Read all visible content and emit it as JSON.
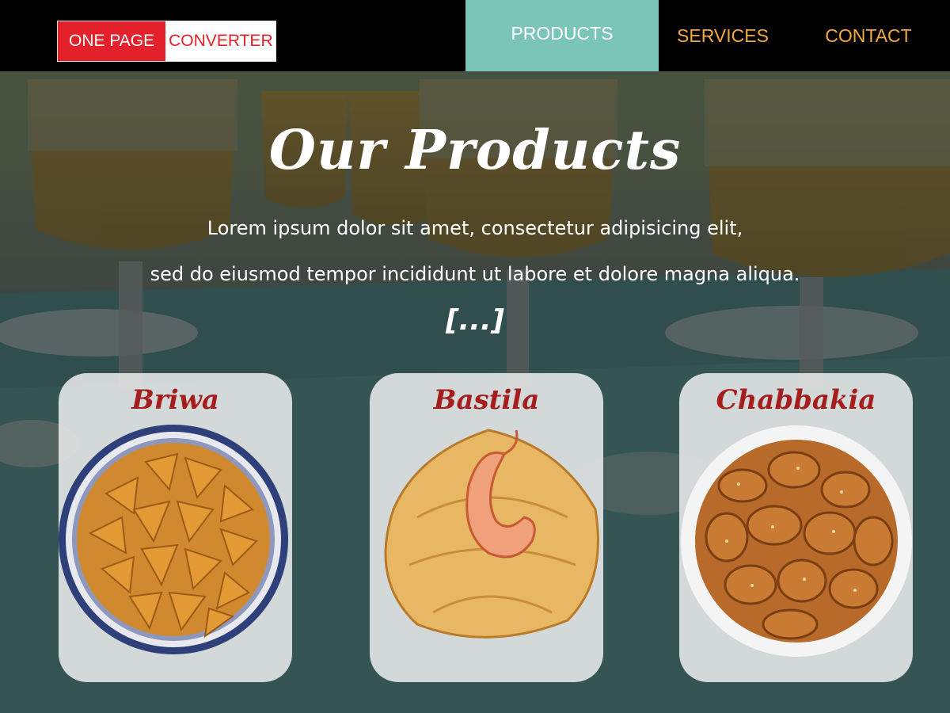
{
  "header": {
    "logo_left": "ONE PAGE",
    "logo_right": "CONVERTER",
    "nav": [
      "PRODUCTS",
      "SERVICES",
      "CONTACT"
    ]
  },
  "hero": {
    "title": "Our Products",
    "line1": "Lorem ipsum dolor sit amet, consectetur adipisicing elit,",
    "line2": "sed do eiusmod tempor incididunt ut labore et dolore magna aliqua.",
    "ellipsis": "[...]"
  },
  "products": [
    {
      "name": "Briwa"
    },
    {
      "name": "Bastila"
    },
    {
      "name": "Chabbakia"
    }
  ],
  "colors": {
    "nav_active_bg": "#7bc4b8",
    "nav_text": "#f2a93b",
    "logo_red": "#e4202a",
    "product_title": "#a61d1d"
  }
}
